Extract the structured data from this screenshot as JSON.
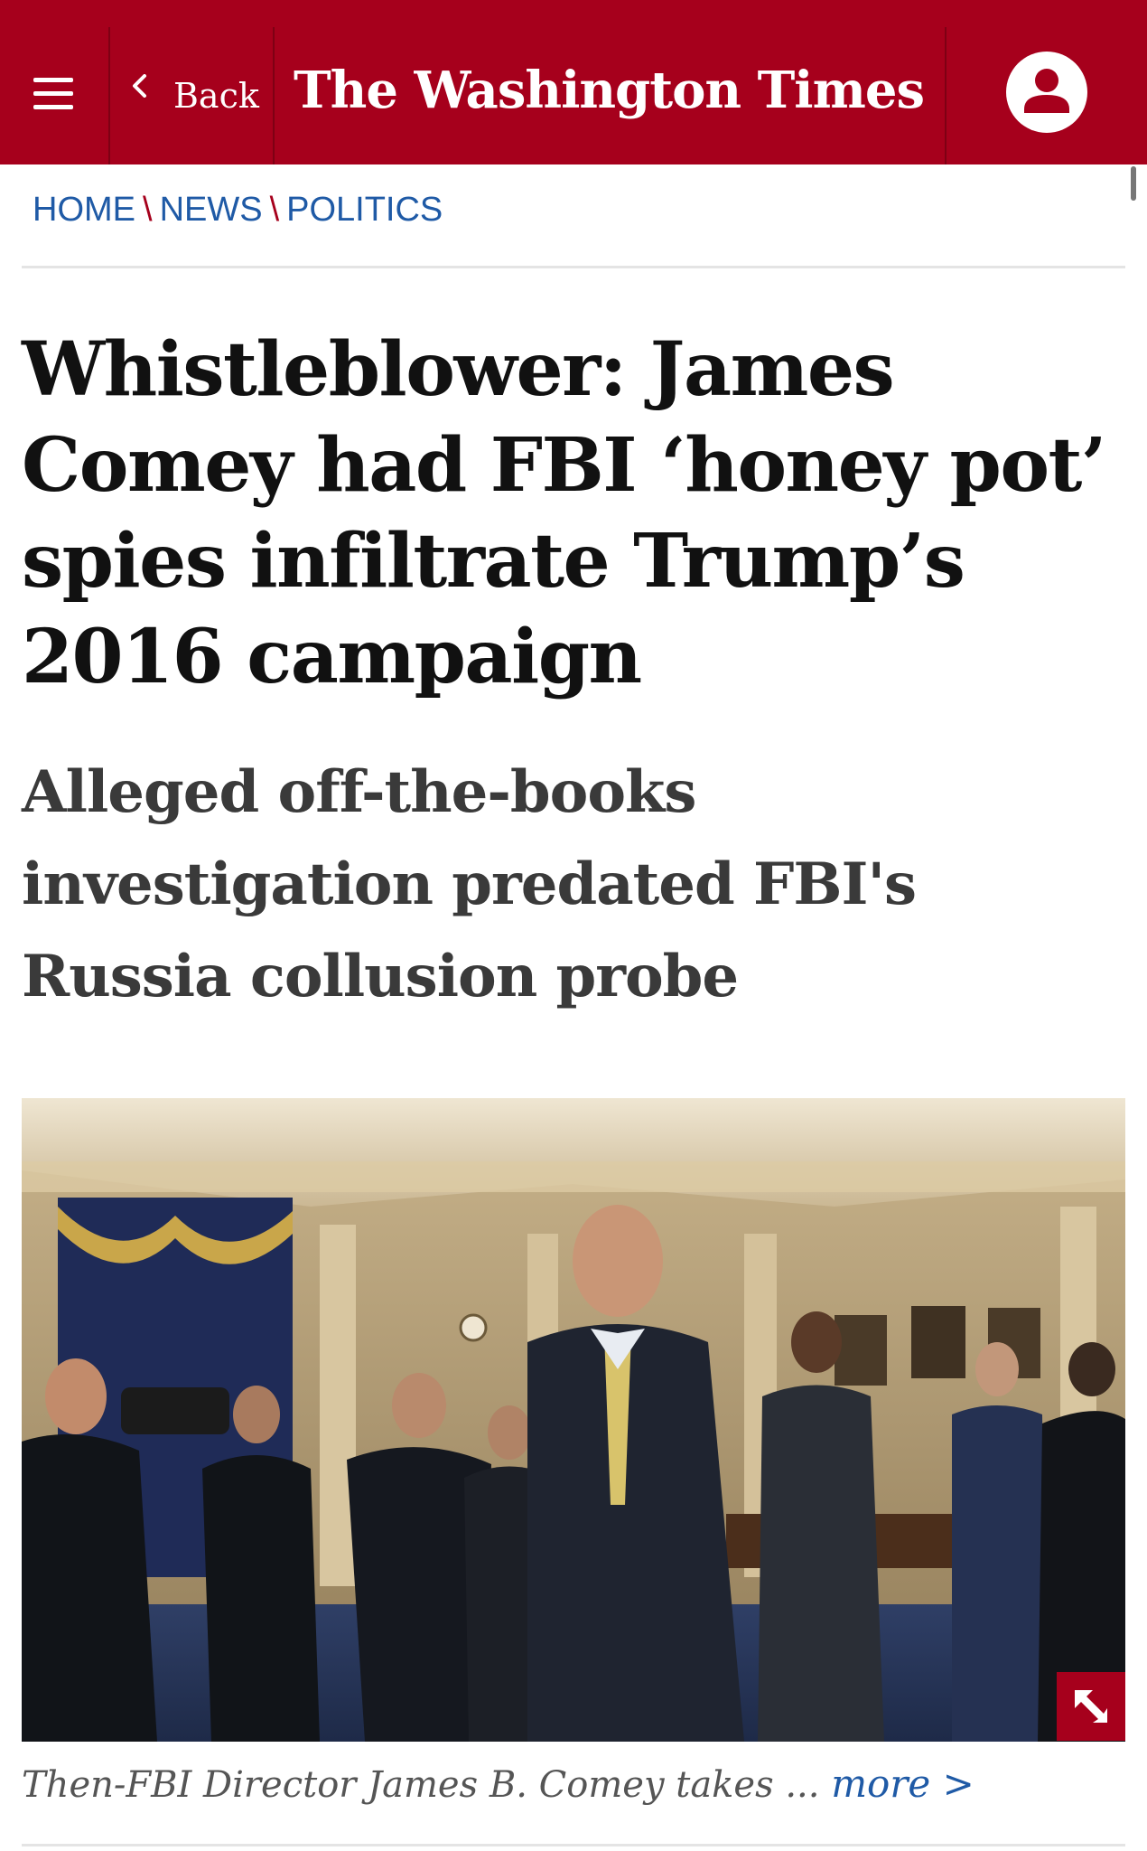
{
  "header": {
    "back_label": "Back",
    "masthead": "The Washington Times",
    "brand_color": "#a6001c",
    "icons": {
      "menu": "hamburger-menu-icon",
      "back": "chevron-left-icon",
      "account": "user-account-icon"
    }
  },
  "breadcrumb": {
    "items": [
      "HOME",
      "NEWS",
      "POLITICS"
    ],
    "separator": "\\"
  },
  "article": {
    "headline": "Whistleblower: James Comey had FBI ‘honey pot’ spies infiltrate Trump’s 2016 campaign",
    "subhead": "Alleged off-the-books investigation predated FBI's Russia collusion probe",
    "photo_caption": "Then-FBI Director James B. Comey takes ...",
    "caption_more": "more >",
    "expand_icon": "expand-arrow-icon"
  }
}
